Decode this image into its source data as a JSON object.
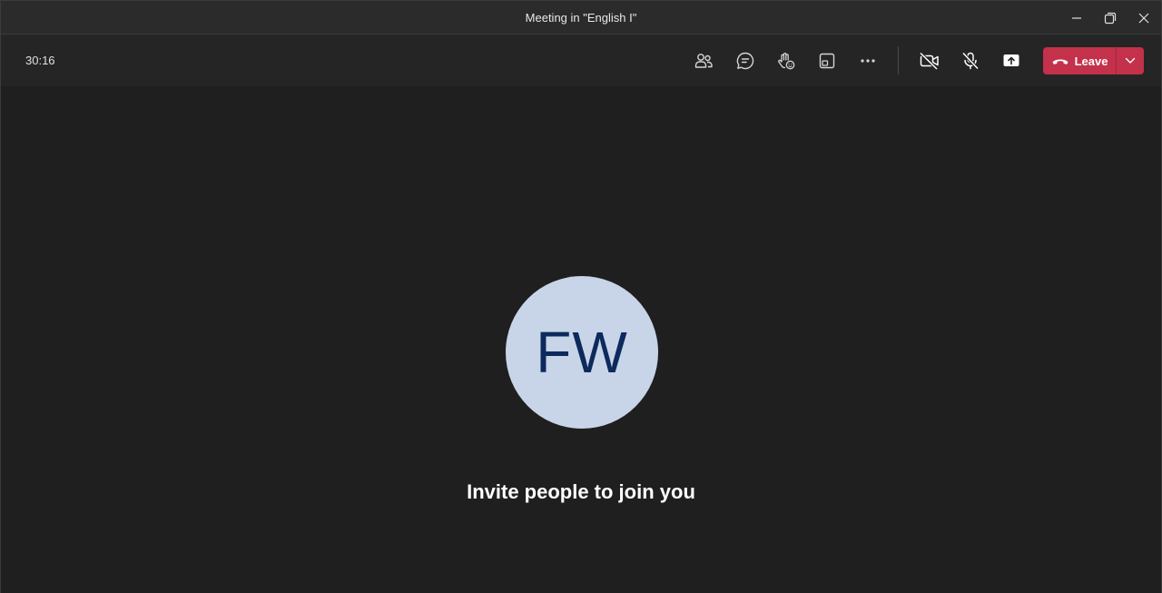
{
  "window": {
    "title": "Meeting in \"English I\""
  },
  "toolbar": {
    "timer": "30:16",
    "leave_label": "Leave",
    "icons": {
      "people": "people-icon",
      "chat": "chat-icon",
      "reactions": "raise-hand-icon",
      "rooms": "breakout-rooms-icon",
      "more": "more-options-icon",
      "camera": "camera-off-icon",
      "mic": "mic-off-icon",
      "share": "share-tray-icon",
      "leave": "phone-hangup-icon",
      "leave_dropdown": "chevron-down-icon"
    },
    "colors": {
      "leave_bg": "#c4314b"
    }
  },
  "stage": {
    "avatar_initials": "FW",
    "avatar_bg": "#c8d5e8",
    "avatar_text_color": "#0d2a5c",
    "invite_text": "Invite people to join you"
  }
}
